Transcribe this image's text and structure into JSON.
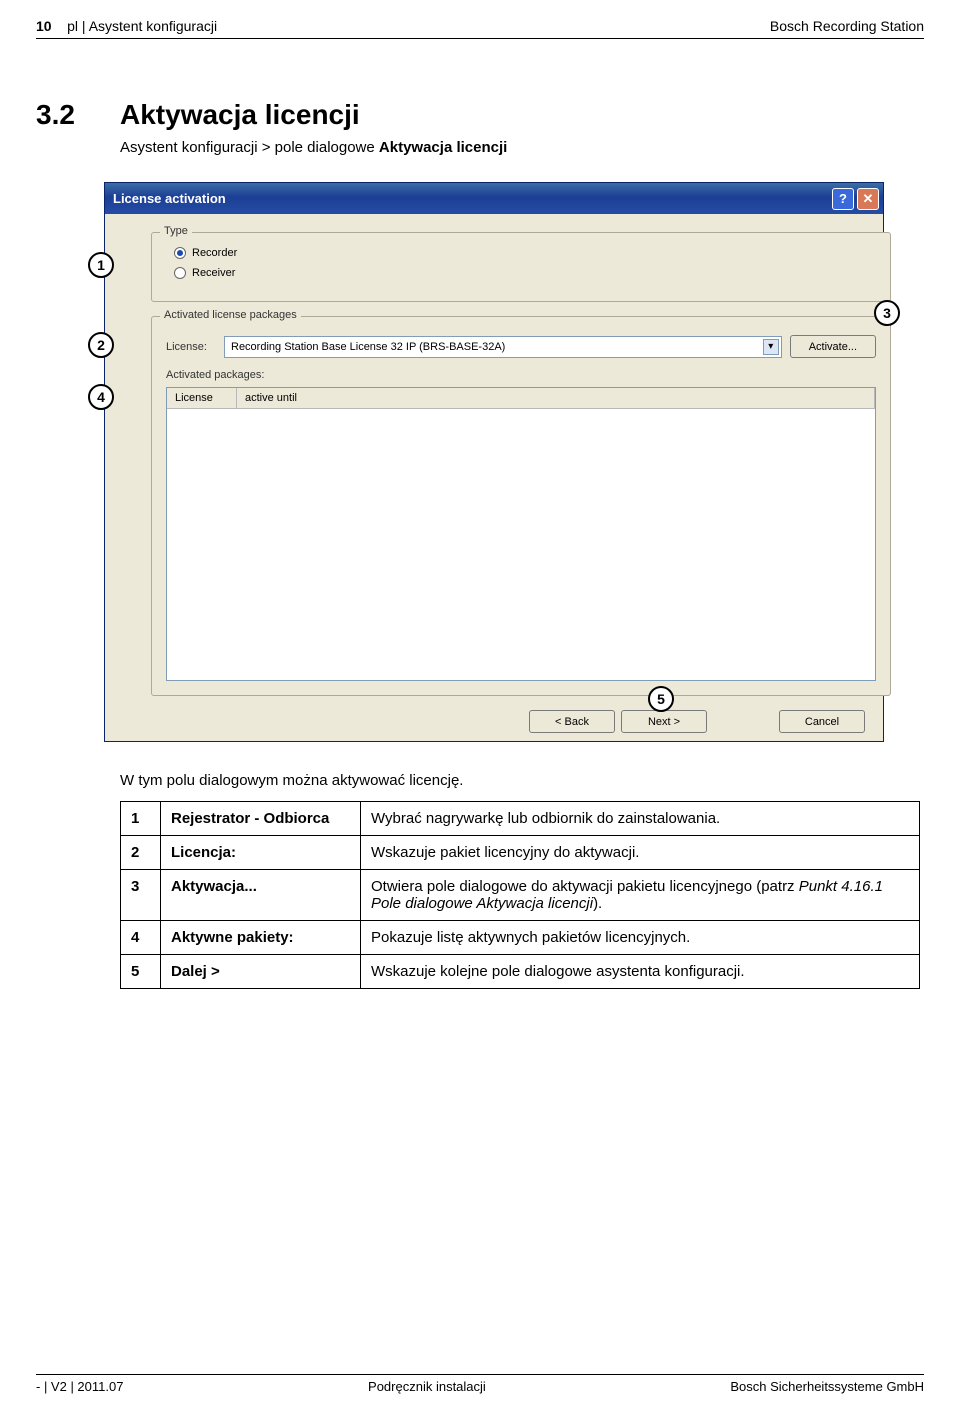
{
  "header": {
    "page": "10",
    "left_lang": "pl",
    "left_sep": " | ",
    "left_section": "Asystent konfiguracji",
    "right": "Bosch Recording Station"
  },
  "section": {
    "number": "3.2",
    "title": "Aktywacja licencji"
  },
  "breadcrumb": {
    "prefix": "Asystent konfiguracji > pole dialogowe ",
    "bold": "Aktywacja licencji"
  },
  "dialog": {
    "title": "License activation",
    "help_glyph": "?",
    "close_glyph": "✕",
    "type_legend": "Type",
    "radio_recorder": "Recorder",
    "radio_receiver": "Receiver",
    "lic_legend": "Activated license packages",
    "license_label": "License:",
    "license_value": "Recording Station Base License 32 IP (BRS-BASE-32A)",
    "dropdown_glyph": "▾",
    "activate_btn": "Activate...",
    "activated_packages_label": "Activated packages:",
    "col1": "License",
    "col2": "active until",
    "back_btn": "< Back",
    "next_btn": "Next >",
    "cancel_btn": "Cancel"
  },
  "callouts": {
    "c1": "1",
    "c2": "2",
    "c3": "3",
    "c4": "4",
    "c5": "5"
  },
  "after_text": "W tym polu dialogowym można aktywować licencję.",
  "table": {
    "rows": [
      {
        "n": "1",
        "label": "Rejestrator - Odbiorca",
        "desc": "Wybrać nagrywarkę lub odbiornik do zainstalowania."
      },
      {
        "n": "2",
        "label": "Licencja:",
        "desc": "Wskazuje pakiet licencyjny do aktywacji."
      },
      {
        "n": "3",
        "label": "Aktywacja...",
        "desc_prefix": "Otwiera pole dialogowe do aktywacji pakietu licencyjnego (patrz ",
        "desc_italic": "Punkt 4.16.1 Pole dialogowe Aktywacja licencji",
        "desc_suffix": ")."
      },
      {
        "n": "4",
        "label": "Aktywne pakiety:",
        "desc": "Pokazuje listę aktywnych pakietów licencyjnych."
      },
      {
        "n": "5",
        "label": "Dalej >",
        "desc": "Wskazuje kolejne pole dialogowe asystenta konfiguracji."
      }
    ]
  },
  "footer": {
    "left": "- | V2 | 2011.07",
    "center": "Podręcznik instalacji",
    "right": "Bosch Sicherheitssysteme GmbH"
  }
}
